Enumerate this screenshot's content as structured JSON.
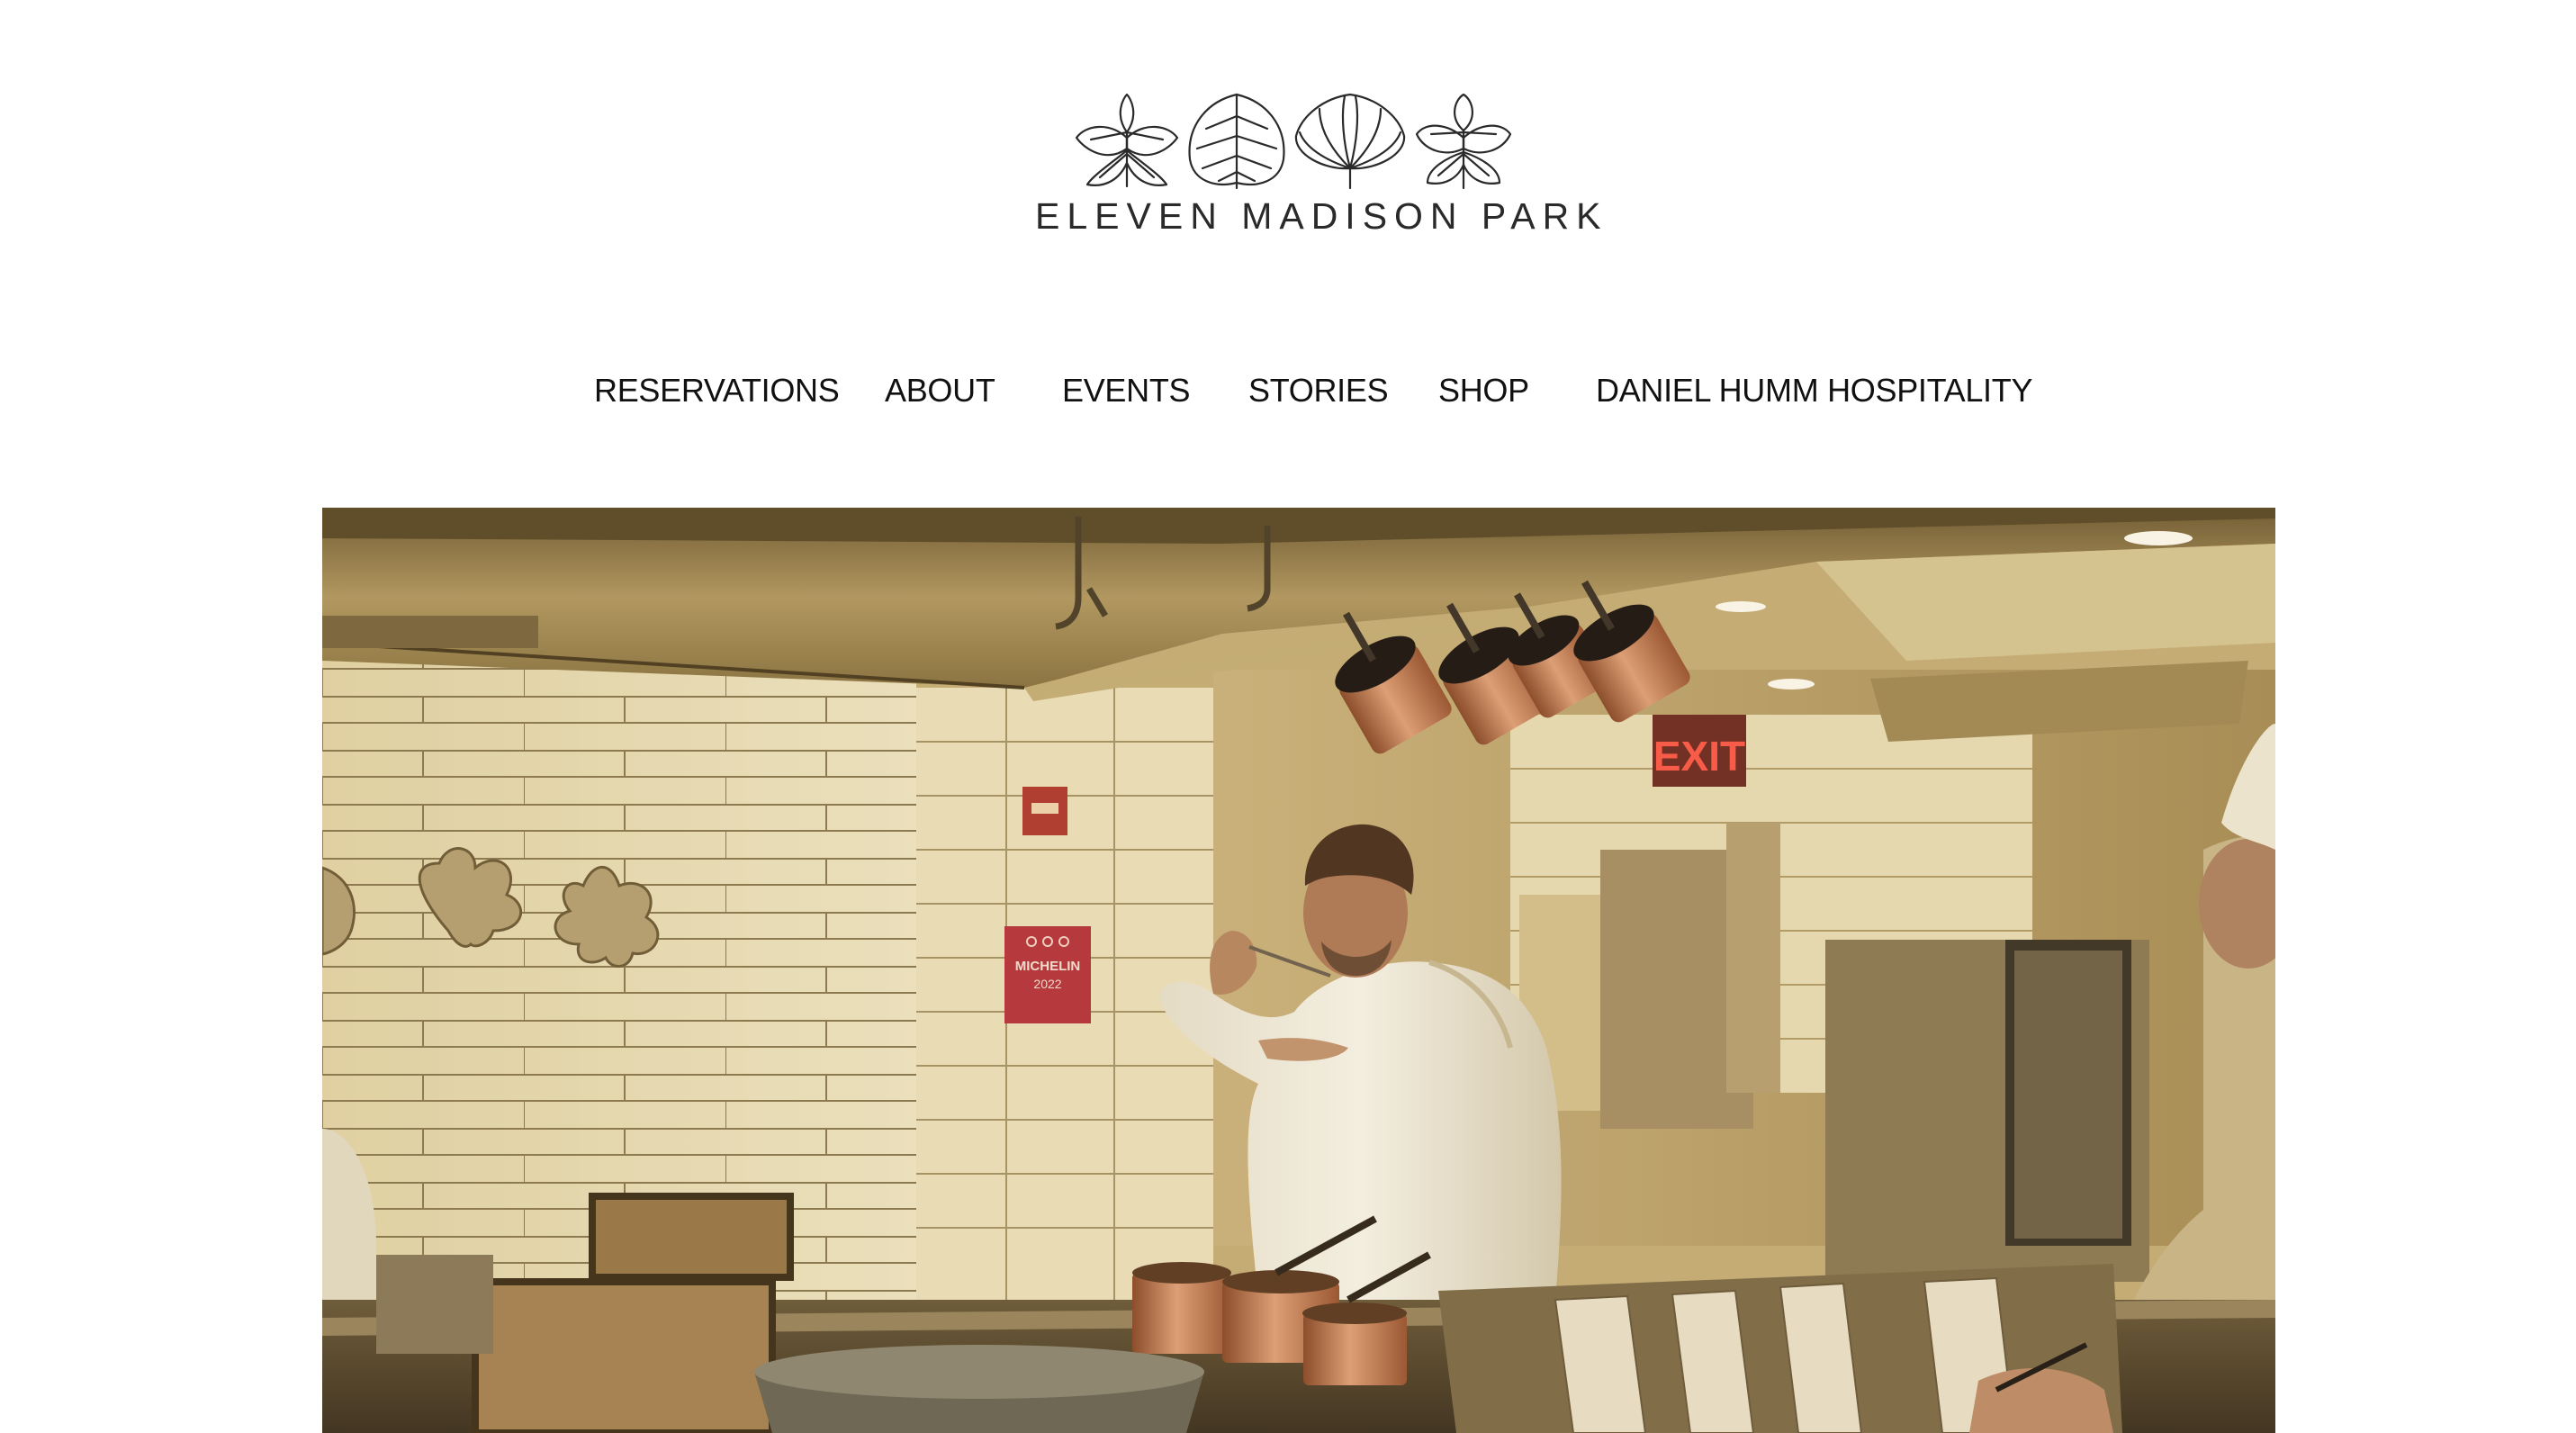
{
  "brand": {
    "wordmark": "ELEVEN MADISON PARK",
    "logo_icon": "four-leaf-marks-logo"
  },
  "nav": {
    "items": [
      {
        "label": "RESERVATIONS"
      },
      {
        "label": "ABOUT"
      },
      {
        "label": "EVENTS"
      },
      {
        "label": "STORIES"
      },
      {
        "label": "SHOP"
      },
      {
        "label": "DANIEL HUMM HOSPITALITY"
      }
    ]
  },
  "hero": {
    "subject": "chef-tasting-in-kitchen-photo",
    "sign_text": "EXIT",
    "plaque": {
      "title": "MICHELIN",
      "year": "2022"
    }
  },
  "colors": {
    "background": "#ffffff",
    "text": "#111111",
    "photo_tone": "#b79a5e",
    "plaque_red": "#b8353d",
    "copper": "#c07a4e"
  }
}
